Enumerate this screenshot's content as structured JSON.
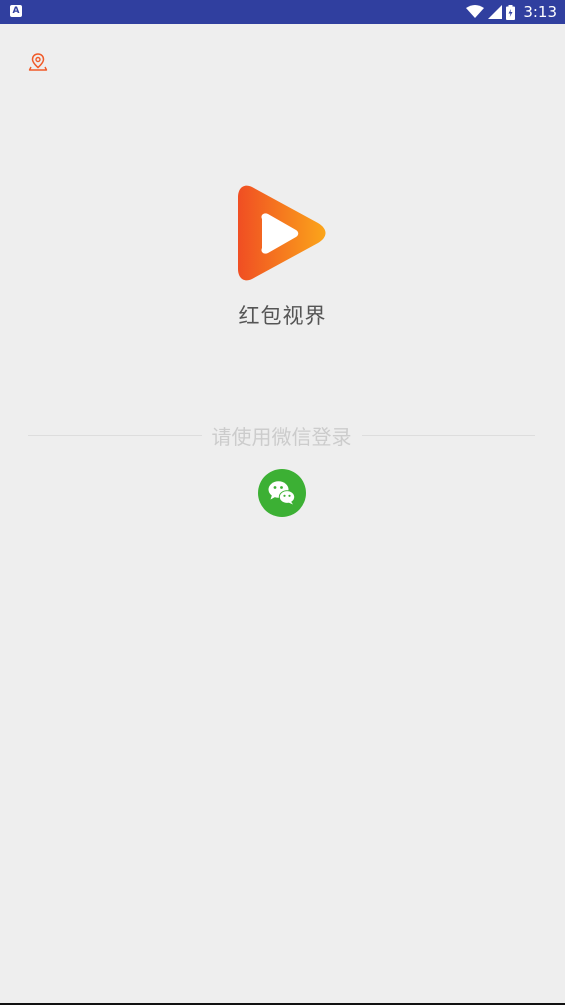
{
  "status_bar": {
    "left_icon": "A",
    "icons": [
      "wifi-icon",
      "signal-icon",
      "battery-icon"
    ],
    "time": "3:13",
    "bg_color": "#303f9f"
  },
  "location": {
    "icon": "location-pin-icon",
    "color": "#f05a28"
  },
  "app": {
    "name": "红包视界",
    "logo_icon": "play-logo-icon",
    "logo_colors": [
      "#f04e23",
      "#fba51a"
    ]
  },
  "login": {
    "prompt": "请使用微信登录",
    "wechat_icon": "wechat-icon",
    "wechat_color": "#3cb034"
  }
}
